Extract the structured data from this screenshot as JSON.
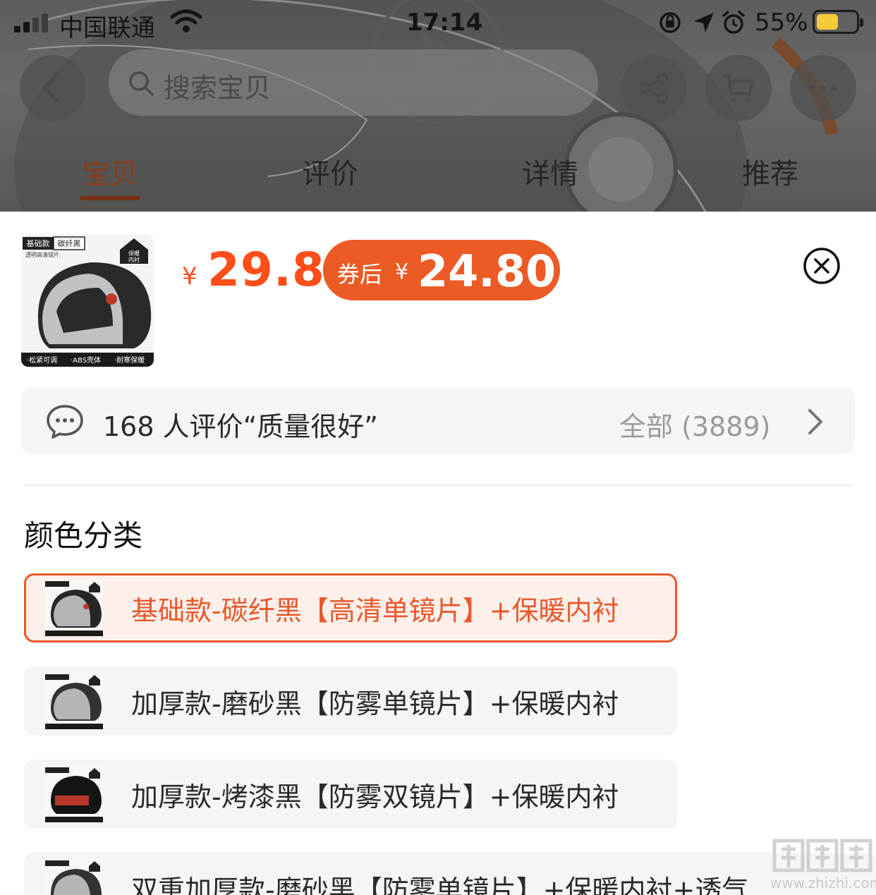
{
  "status_bar": {
    "carrier": "中国联通",
    "time": "17:14",
    "battery_percent": "55%",
    "battery_level": 0.55
  },
  "header": {
    "search_placeholder": "搜索宝贝",
    "tabs": [
      {
        "label": "宝贝",
        "active": true
      },
      {
        "label": "评价",
        "active": false
      },
      {
        "label": "详情",
        "active": false
      },
      {
        "label": "推荐",
        "active": false
      }
    ]
  },
  "sku_sheet": {
    "product_image_texts": {
      "badge_left": "基础款",
      "badge_right": "碳纤黑",
      "subtitle": "透明高清镜片",
      "corner_1": "保暖",
      "corner_2": "内衬",
      "features": [
        "·松紧可调",
        "·ABS壳体",
        "·耐寒保暖"
      ]
    },
    "price_currency": "¥",
    "price": "29.8",
    "coupon": {
      "label": "券后",
      "currency": "¥",
      "value": "24.80"
    },
    "review_summary": "168 人评价“质量很好”",
    "review_all": "全部 (3889)",
    "section_title": "颜色分类",
    "options": [
      {
        "label": "基础款-碳纤黑【高清单镜片】+保暖内衬",
        "selected": true
      },
      {
        "label": "加厚款-磨砂黑【防雾单镜片】+保暖内衬",
        "selected": false
      },
      {
        "label": "加厚款-烤漆黑【防雾双镜片】+保暖内衬",
        "selected": false
      },
      {
        "label": "双重加厚款-磨砂黑【防雾单镜片】+保暖内衬+透气...",
        "selected": false
      }
    ]
  },
  "watermark": {
    "logo": "值值值",
    "domain": "www.zhizhi.com"
  },
  "colors": {
    "accent": "#ff4e1a",
    "coupon_bg": "#ec5a25",
    "selected_border": "#e8582a",
    "option_bg": "#f5f5f5"
  }
}
